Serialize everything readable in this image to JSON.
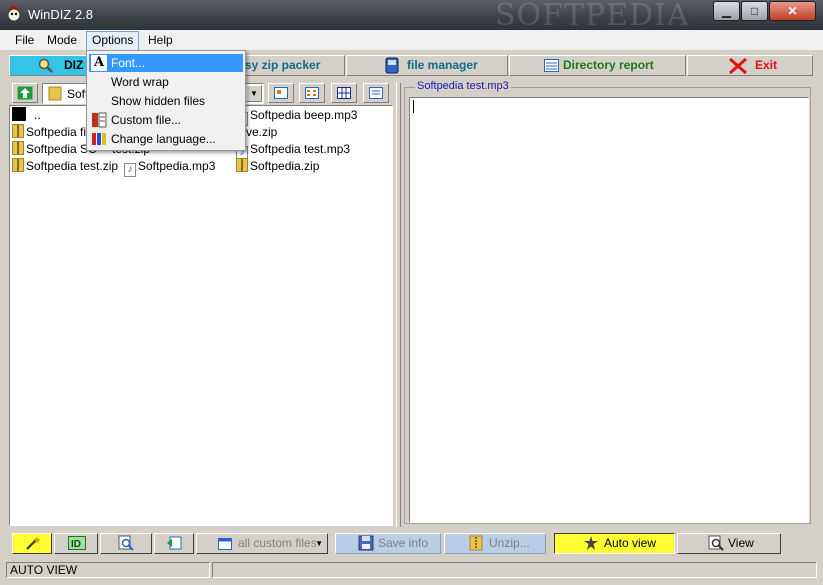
{
  "window": {
    "title": "WinDIZ 2.8",
    "watermark": "SOFTPEDIA",
    "min_icon": "minimize-icon",
    "max_icon": "maximize-icon",
    "close_icon": "close-icon"
  },
  "menubar": {
    "file": "File",
    "mode": "Mode",
    "options": "Options",
    "help": "Help"
  },
  "modes": {
    "diz": "DIZ",
    "zip_packer": "sy zip packer",
    "file_manager": "file manager",
    "directory_report": "Directory report",
    "exit": "Exit"
  },
  "options_menu": {
    "items": [
      {
        "label": "Font...",
        "icon": "font-icon",
        "highlighted": true
      },
      {
        "label": "Word wrap",
        "icon": "",
        "highlighted": false
      },
      {
        "label": "Show hidden files",
        "icon": "",
        "highlighted": false
      },
      {
        "label": "Custom file...",
        "icon": "custom-file-icon",
        "highlighted": false
      },
      {
        "label": "Change language...",
        "icon": "language-icon",
        "highlighted": false
      }
    ]
  },
  "folder_combo": {
    "value": "Soft"
  },
  "files": [
    {
      "name": "..",
      "type": "up"
    },
    {
      "name": "Softpedia beep.mp3",
      "type": "mp3"
    },
    {
      "name": "Softpedia fil",
      "type": "zip"
    },
    {
      "name": "ve.zip",
      "type": "zip"
    },
    {
      "name": "Softpedia SC",
      "type": "zip"
    },
    {
      "name": "test.zip",
      "type": "zip"
    },
    {
      "name": "Softpedia test.mp3",
      "type": "mp3"
    },
    {
      "name": "Softpedia test.zip",
      "type": "zip"
    },
    {
      "name": "Softpedia.mp3",
      "type": "mp3"
    },
    {
      "name": "Softpedia.zip",
      "type": "zip"
    }
  ],
  "viewer": {
    "caption": "Softpedia test.mp3"
  },
  "bottom": {
    "filter": "all custom files",
    "save_info": "Save info",
    "unzip": "Unzip...",
    "auto_view": "Auto view",
    "view": "View"
  },
  "status": {
    "mode": "AUTO VIEW"
  },
  "colors": {
    "accent": "#33c4e8",
    "highlight": "#3399ff",
    "auto_view_bg": "#ffff33",
    "exit_red": "#e01010",
    "caption_blue": "#1a1aa8"
  }
}
